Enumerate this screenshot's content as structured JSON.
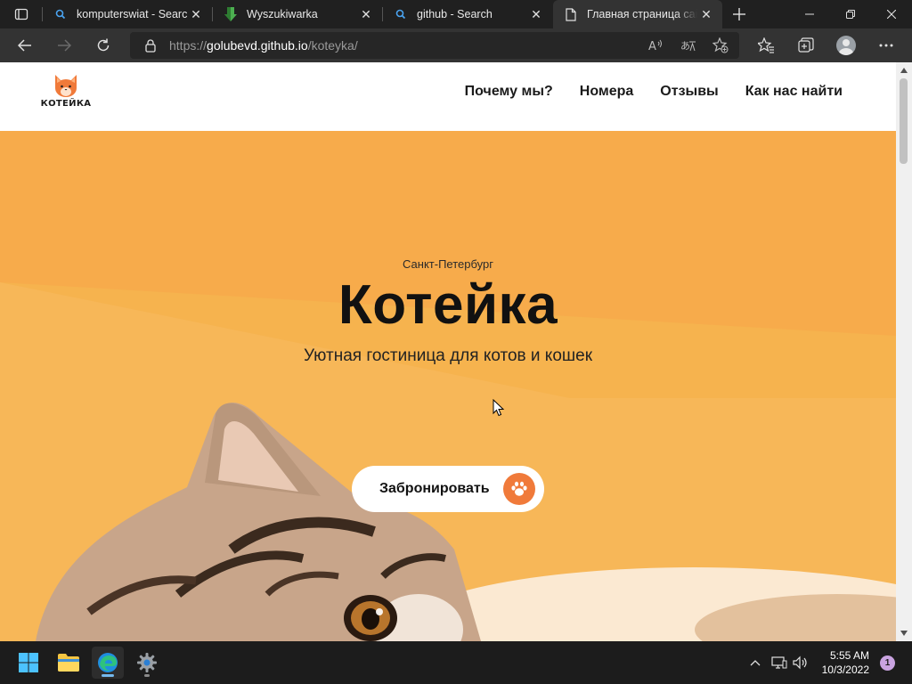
{
  "browser": {
    "tabs": [
      {
        "title": "komputerswiat - Search",
        "favicon": "search-icon"
      },
      {
        "title": "Wyszukiwarka",
        "favicon": "download-arrow-icon"
      },
      {
        "title": "github - Search",
        "favicon": "search-icon"
      },
      {
        "title": "Главная страница сайта",
        "favicon": "document-icon",
        "active": true
      }
    ],
    "url": {
      "scheme": "https://",
      "host": "golubevd.github.io",
      "path": "/koteyka/"
    },
    "accent_color": "#4aa3f0"
  },
  "site": {
    "logo_text": "КОТЕЙКА",
    "nav": [
      "Почему мы?",
      "Номера",
      "Отзывы",
      "Как нас найти"
    ],
    "hero": {
      "city": "Санкт-Петербург",
      "title": "Котейка",
      "tagline": "Уютная гостиница для котов и кошек",
      "book_button": "Забронировать",
      "background_color": "#f7b14f",
      "accent_color": "#f07a3a"
    }
  },
  "taskbar": {
    "time": "5:55 AM",
    "date": "10/3/2022",
    "notification_count": "1"
  }
}
